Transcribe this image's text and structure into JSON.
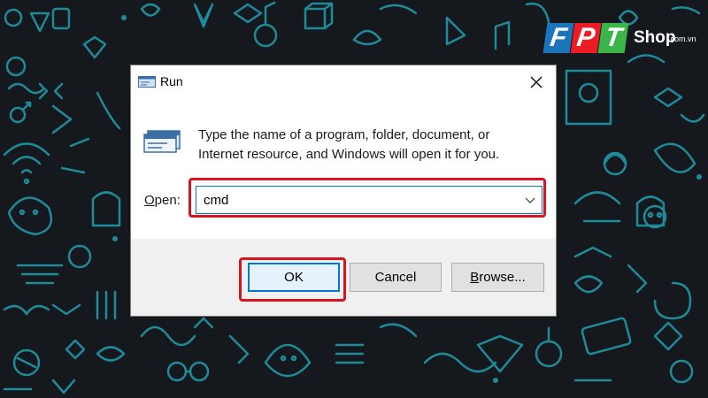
{
  "brand": {
    "letters": [
      "F",
      "P",
      "T"
    ],
    "shop": "Shop",
    "domain": ".com.vn",
    "colors": [
      "#1b75bb",
      "#ed1c24",
      "#39b54a"
    ]
  },
  "dialog": {
    "title": "Run",
    "icon": "run-program-icon",
    "description_line1": "Type the name of a program, folder, document, or",
    "description_line2": "Internet resource, and Windows will open it for you.",
    "open_label_prefix": "O",
    "open_label_rest": "pen:",
    "open_value": "cmd",
    "buttons": {
      "ok": "OK",
      "cancel": "Cancel",
      "browse_prefix": "B",
      "browse_rest": "rowse..."
    }
  },
  "colors": {
    "background": "#15191d",
    "doodle": "#1f8a9a",
    "highlight": "#d9141f",
    "focus": "#0078d7"
  }
}
